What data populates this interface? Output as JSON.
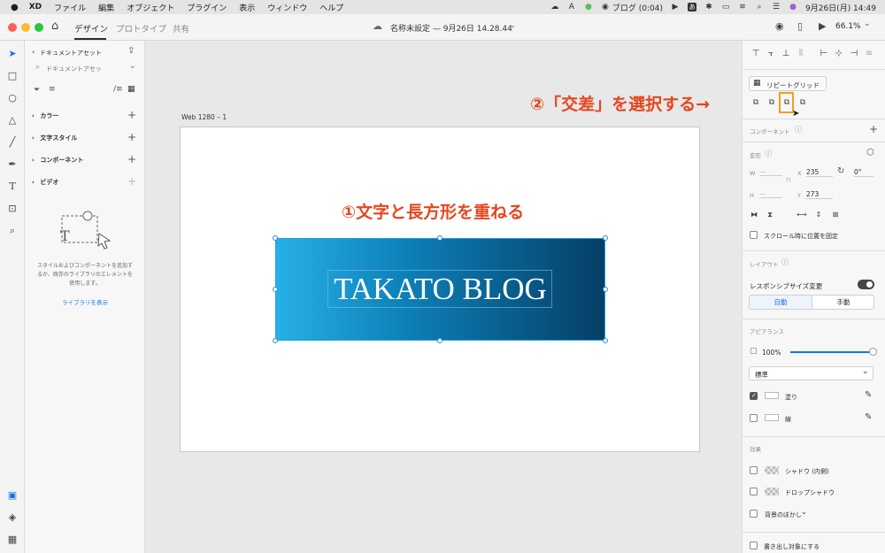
{
  "menubar": {
    "app": "XD",
    "items": [
      "ファイル",
      "編集",
      "オブジェクト",
      "プラグイン",
      "表示",
      "ウィンドウ",
      "ヘルプ"
    ],
    "status": {
      "recording": "ブログ (0:04)",
      "datetime": "9月26日(月)  14:49"
    }
  },
  "titlebar": {
    "tabs": [
      "デザイン",
      "プロトタイプ",
      "共有"
    ],
    "doc_title": "名称未設定 — 9月26日 14.28.44",
    "zoom": "66.1%"
  },
  "assets": {
    "header": "ドキュメントアセット",
    "search_placeholder": "ドキュメントアセッ",
    "sections": [
      "カラー",
      "文字スタイル",
      "コンポーネント",
      "ビデオ"
    ],
    "empty_text": [
      "スタイルおよびコンポーネントを追加す",
      "るか、既存のライブラリのエレメントを",
      "使用します。"
    ],
    "library_link": "ライブラリを表示"
  },
  "canvas": {
    "artboard_label": "Web 1280 – 1",
    "blog_text": "TAKATO BLOG",
    "annotation_1": "①文字と長方形を重ねる",
    "annotation_2": "②「交差」を選択する→"
  },
  "props": {
    "repeat_grid": "リピートグリッド",
    "components_label": "コンポーネント",
    "transform_label": "変形",
    "w_label": "W",
    "h_label": "H",
    "w_value": "—",
    "h_value": "—",
    "x_label": "X",
    "x_value": "235",
    "y_label": "Y",
    "y_value": "273",
    "rotation": "0°",
    "fix_scroll": "スクロール時に位置を固定",
    "layout_label": "レイアウト",
    "responsive_resize": "レスポンシブサイズ変更",
    "auto": "自動",
    "manual": "手動",
    "appearance_label": "アピアランス",
    "opacity": "100%",
    "blend_mode": "標準",
    "fill": "塗り",
    "border": "線",
    "effects_label": "効果",
    "inner_shadow": "シャドウ (内側)",
    "drop_shadow": "ドロップシャドウ",
    "bg_blur": "背景のぼかし",
    "export_target": "書き出し対象にする"
  },
  "colors": {
    "accent": "#1473e6",
    "annotation": "#e5461f",
    "highlight": "#f0a020"
  }
}
